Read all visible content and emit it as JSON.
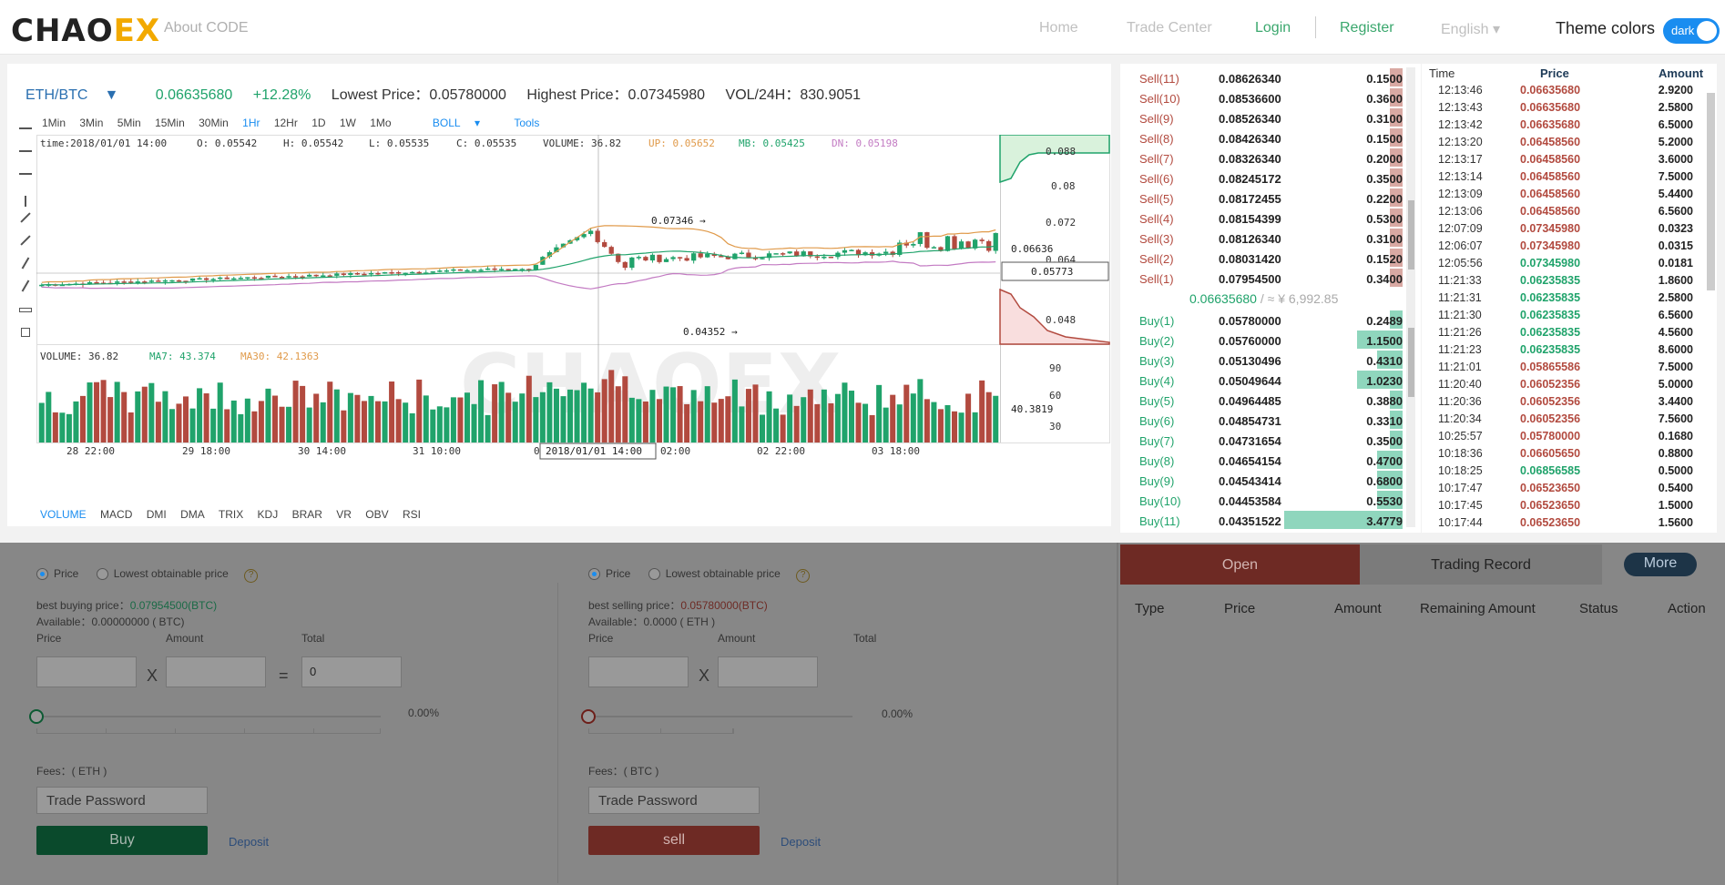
{
  "header": {
    "logo_part1": "CHAO",
    "logo_part2": "EX",
    "about": "About CODE",
    "nav": [
      "Home",
      "Trade Center",
      "Login",
      "Register"
    ],
    "language": "English",
    "theme_label": "Theme colors",
    "theme_value": "dark"
  },
  "ticker": {
    "pair": "ETH/BTC",
    "price": "0.06635680",
    "change": "+12.28%",
    "low": "Lowest Price：0.05780000",
    "high": "Highest Price：0.07345980",
    "vol": "VOL/24H：830.9051"
  },
  "timeframes": [
    "1Min",
    "3Min",
    "5Min",
    "15Min",
    "30Min",
    "1Hr",
    "12Hr",
    "1D",
    "1W",
    "1Mo"
  ],
  "active_timeframe": "1Hr",
  "boll": "BOLL",
  "tools": "Tools",
  "chart_data": {
    "type": "candlestick",
    "info": {
      "time": "time:2018/01/01 14:00",
      "o": "O: 0.05542",
      "h": "H: 0.05542",
      "l": "L: 0.05535",
      "c": "C: 0.05535",
      "volume": "VOLUME: 36.82",
      "up": "UP: 0.05652",
      "mb": "MB: 0.05425",
      "dn": "DN: 0.05198"
    },
    "price_axis": [
      "0.088",
      "0.08",
      "0.072",
      "0.064",
      "0.048"
    ],
    "current_price_label": "0.06636",
    "crosshair_price_label": "0.05773",
    "max_annotation": "0.07346 →",
    "min_annotation": "0.04352 →",
    "volume_info": {
      "volume": "VOLUME: 36.82",
      "ma7": "MA7: 43.374",
      "ma30": "MA30: 42.1363"
    },
    "volume_axis": [
      "90",
      "60",
      "30"
    ],
    "volume_marker": "40.3819",
    "x_labels": [
      "28 22:00",
      "29 18:00",
      "30 14:00",
      "31 10:00",
      "01",
      "02:00",
      "02 22:00",
      "03 18:00"
    ],
    "crosshair_time": "2018/01/01 14:00",
    "up_color": "#20a36b",
    "down_color": "#b24a3f"
  },
  "indicators": [
    "VOLUME",
    "MACD",
    "DMI",
    "DMA",
    "TRIX",
    "KDJ",
    "BRAR",
    "VR",
    "OBV",
    "RSI"
  ],
  "active_indicator": "VOLUME",
  "orderbook": {
    "sells": [
      {
        "label": "Sell(11)",
        "price": "0.08626340",
        "amount": "0.1500"
      },
      {
        "label": "Sell(10)",
        "price": "0.08536600",
        "amount": "0.3600"
      },
      {
        "label": "Sell(9)",
        "price": "0.08526340",
        "amount": "0.3100"
      },
      {
        "label": "Sell(8)",
        "price": "0.08426340",
        "amount": "0.1500"
      },
      {
        "label": "Sell(7)",
        "price": "0.08326340",
        "amount": "0.2000"
      },
      {
        "label": "Sell(6)",
        "price": "0.08245172",
        "amount": "0.3500"
      },
      {
        "label": "Sell(5)",
        "price": "0.08172455",
        "amount": "0.2200"
      },
      {
        "label": "Sell(4)",
        "price": "0.08154399",
        "amount": "0.5300"
      },
      {
        "label": "Sell(3)",
        "price": "0.08126340",
        "amount": "0.3100"
      },
      {
        "label": "Sell(2)",
        "price": "0.08031420",
        "amount": "0.1520"
      },
      {
        "label": "Sell(1)",
        "price": "0.07954500",
        "amount": "0.3400"
      }
    ],
    "mid_price": "0.06635680",
    "mid_cny": " / ≈ ¥ 6,992.85",
    "buys": [
      {
        "label": "Buy(1)",
        "price": "0.05780000",
        "amount": "0.2489"
      },
      {
        "label": "Buy(2)",
        "price": "0.05760000",
        "amount": "1.1500"
      },
      {
        "label": "Buy(3)",
        "price": "0.05130496",
        "amount": "0.4310"
      },
      {
        "label": "Buy(4)",
        "price": "0.05049644",
        "amount": "1.0230"
      },
      {
        "label": "Buy(5)",
        "price": "0.04964485",
        "amount": "0.3880"
      },
      {
        "label": "Buy(6)",
        "price": "0.04854731",
        "amount": "0.3310"
      },
      {
        "label": "Buy(7)",
        "price": "0.04731654",
        "amount": "0.3500"
      },
      {
        "label": "Buy(8)",
        "price": "0.04654154",
        "amount": "0.4700"
      },
      {
        "label": "Buy(9)",
        "price": "0.04543414",
        "amount": "0.6800"
      },
      {
        "label": "Buy(10)",
        "price": "0.04453584",
        "amount": "0.5530"
      },
      {
        "label": "Buy(11)",
        "price": "0.04351522",
        "amount": "3.4779"
      }
    ]
  },
  "trades": {
    "headers": [
      "Time",
      "Price",
      "Amount"
    ],
    "rows": [
      {
        "time": "12:13:46",
        "price": "0.06635680",
        "amount": "2.9200",
        "side": "sell"
      },
      {
        "time": "12:13:43",
        "price": "0.06635680",
        "amount": "2.5800",
        "side": "sell"
      },
      {
        "time": "12:13:42",
        "price": "0.06635680",
        "amount": "6.5000",
        "side": "sell"
      },
      {
        "time": "12:13:20",
        "price": "0.06458560",
        "amount": "5.2000",
        "side": "sell"
      },
      {
        "time": "12:13:17",
        "price": "0.06458560",
        "amount": "3.6000",
        "side": "sell"
      },
      {
        "time": "12:13:14",
        "price": "0.06458560",
        "amount": "7.5000",
        "side": "sell"
      },
      {
        "time": "12:13:09",
        "price": "0.06458560",
        "amount": "5.4400",
        "side": "sell"
      },
      {
        "time": "12:13:06",
        "price": "0.06458560",
        "amount": "6.5600",
        "side": "sell"
      },
      {
        "time": "12:07:09",
        "price": "0.07345980",
        "amount": "0.0323",
        "side": "sell"
      },
      {
        "time": "12:06:07",
        "price": "0.07345980",
        "amount": "0.0315",
        "side": "sell"
      },
      {
        "time": "12:05:56",
        "price": "0.07345980",
        "amount": "0.0181",
        "side": "buy"
      },
      {
        "time": "11:21:33",
        "price": "0.06235835",
        "amount": "1.8600",
        "side": "buy"
      },
      {
        "time": "11:21:31",
        "price": "0.06235835",
        "amount": "2.5800",
        "side": "buy"
      },
      {
        "time": "11:21:30",
        "price": "0.06235835",
        "amount": "6.5600",
        "side": "buy"
      },
      {
        "time": "11:21:26",
        "price": "0.06235835",
        "amount": "4.5600",
        "side": "buy"
      },
      {
        "time": "11:21:23",
        "price": "0.06235835",
        "amount": "8.6000",
        "side": "buy"
      },
      {
        "time": "11:21:01",
        "price": "0.05865586",
        "amount": "7.5000",
        "side": "sell"
      },
      {
        "time": "11:20:40",
        "price": "0.06052356",
        "amount": "5.0000",
        "side": "sell"
      },
      {
        "time": "11:20:36",
        "price": "0.06052356",
        "amount": "3.4400",
        "side": "sell"
      },
      {
        "time": "11:20:34",
        "price": "0.06052356",
        "amount": "7.5600",
        "side": "sell"
      },
      {
        "time": "10:25:57",
        "price": "0.05780000",
        "amount": "0.1680",
        "side": "sell"
      },
      {
        "time": "10:18:36",
        "price": "0.06605650",
        "amount": "0.8800",
        "side": "sell"
      },
      {
        "time": "10:18:25",
        "price": "0.06856585",
        "amount": "0.5000",
        "side": "buy"
      },
      {
        "time": "10:17:47",
        "price": "0.06523650",
        "amount": "0.5400",
        "side": "sell"
      },
      {
        "time": "10:17:45",
        "price": "0.06523650",
        "amount": "1.5000",
        "side": "sell"
      },
      {
        "time": "10:17:44",
        "price": "0.06523650",
        "amount": "1.5600",
        "side": "sell"
      }
    ]
  },
  "buy_form": {
    "radio_price": "Price",
    "radio_lowest": "Lowest obtainable price",
    "help": "?",
    "best_price": "best buying price：",
    "best_price_value": "0.07954500(BTC)",
    "available": "Available：0.00000000 ( BTC)",
    "price_label": "Price",
    "amount_label": "Amount",
    "total_label": "Total",
    "x": "X",
    "eq": "=",
    "total_value": "0",
    "percent": "0.00%",
    "fees": "Fees：( ETH )",
    "password_placeholder": "Trade Password",
    "button": "Buy",
    "deposit": "Deposit"
  },
  "sell_form": {
    "radio_price": "Price",
    "radio_lowest": "Lowest obtainable price",
    "help": "?",
    "best_price": "best selling price：",
    "best_price_value": "0.05780000(BTC)",
    "available": "Available：0.0000 ( ETH )",
    "price_label": "Price",
    "amount_label": "Amount",
    "total_label": "Total",
    "x": "X",
    "percent": "0.00%",
    "fees": "Fees：( BTC )",
    "password_placeholder": "Trade Password",
    "button": "sell",
    "deposit": "Deposit"
  },
  "orders": {
    "tab_open": "Open",
    "tab_record": "Trading Record",
    "more": "More",
    "columns": [
      "Type",
      "Price",
      "Amount",
      "Remaining Amount",
      "Status",
      "Action"
    ]
  }
}
